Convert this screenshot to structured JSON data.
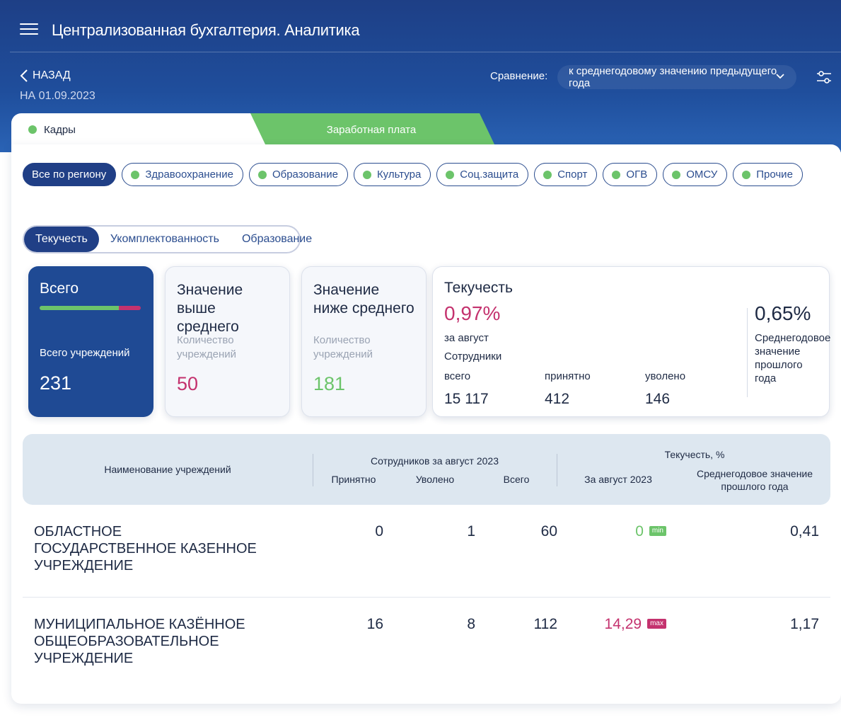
{
  "app": {
    "title": "Централизованная бухгалтерия. Аналитика"
  },
  "nav": {
    "back_label": "НАЗАД",
    "date": "НА 01.09.2023"
  },
  "comparison": {
    "label": "Сравнение:",
    "value": "к среднегодовому значению предыдущего года"
  },
  "tabs": [
    {
      "label": "Кадры",
      "active": true
    },
    {
      "label": "Заработная плата",
      "active": false
    }
  ],
  "categories": [
    {
      "label": "Все по региону",
      "active": true
    },
    {
      "label": "Здравоохранение"
    },
    {
      "label": "Образование"
    },
    {
      "label": "Культура"
    },
    {
      "label": "Соц.защита"
    },
    {
      "label": "Спорт"
    },
    {
      "label": "ОГВ"
    },
    {
      "label": "ОМСУ"
    },
    {
      "label": "Прочие"
    }
  ],
  "subtabs": [
    {
      "label": "Текучесть",
      "active": true
    },
    {
      "label": "Укомплектованность"
    },
    {
      "label": "Образование"
    }
  ],
  "cards": {
    "total": {
      "title": "Всего",
      "label": "Всего учреждений",
      "value": "231",
      "above_share": 0.78
    },
    "above": {
      "title": "Значение выше среднего",
      "label": "Количество учреждений",
      "value": "50"
    },
    "below": {
      "title": "Значение ниже среднего",
      "label": "Количество учреждений",
      "value": "181"
    },
    "turnover": {
      "title": "Текучесть",
      "value": "0,97%",
      "period": "за август",
      "staff_label": "Сотрудники",
      "total_label": "всего",
      "total_value": "15 117",
      "hired_label": "принятно",
      "hired_value": "412",
      "fired_label": "уволено",
      "fired_value": "146",
      "avg_value": "0,65%",
      "avg_label": "Среднегодовое значение прошлого года"
    }
  },
  "table": {
    "headers": {
      "name": "Наименование учреждений",
      "staff_group": "Сотрудников за август 2023",
      "hired": "Принятно",
      "fired": "Уволено",
      "total": "Всего",
      "turnover_group": "Текучесть, %",
      "month": "За август 2023",
      "avg": "Среднегодовое значение прошлого года"
    },
    "rows": [
      {
        "name": "ОБЛАСТНОЕ ГОСУДАРСТВЕННОЕ КАЗЕННОЕ УЧРЕЖДЕНИЕ",
        "hired": "0",
        "fired": "1",
        "total": "60",
        "month": "0",
        "badge": "min",
        "avg": "0,41"
      },
      {
        "name": "МУНИЦИПАЛЬНОЕ КАЗЁННОЕ ОБЩЕОБРАЗОВАТЕЛЬНОЕ УЧРЕЖДЕНИЕ",
        "hired": "16",
        "fired": "8",
        "total": "112",
        "month": "14,29",
        "badge": "max",
        "avg": "1,17"
      }
    ]
  },
  "colors": {
    "primary": "#203f86",
    "green": "#6cc46a",
    "pink": "#c4326e"
  }
}
